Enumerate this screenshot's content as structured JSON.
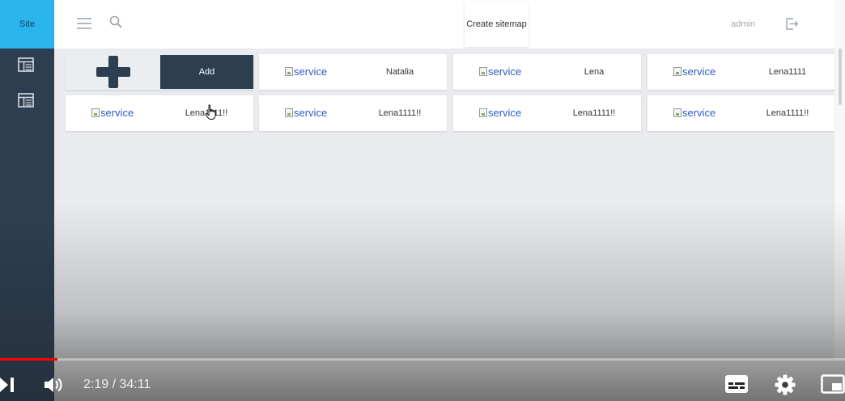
{
  "sidebar": {
    "site_label": "Site",
    "items": [
      {
        "icon": "layout-icon"
      },
      {
        "icon": "layout-icon"
      }
    ]
  },
  "header": {
    "create_sitemap_label": "Create sitemap",
    "user_label": "admin"
  },
  "main": {
    "add_label": "Add",
    "image_alt": "service",
    "services": [
      {
        "name": "Natalia"
      },
      {
        "name": "Lena"
      },
      {
        "name": "Lena1111"
      },
      {
        "name": "Lena1111!!"
      },
      {
        "name": "Lena1111!!"
      },
      {
        "name": "Lena1111!!"
      },
      {
        "name": "Lena1111!!"
      }
    ]
  },
  "player": {
    "time_display": "2:19 / 34:11",
    "progress_fraction": 0.068
  },
  "colors": {
    "sidebar": "#2c3e50",
    "site_tab": "#2ab5ec",
    "add_button": "#2c3e50",
    "link_blue": "#2c5cc5",
    "content_bg": "#e9ebee"
  }
}
